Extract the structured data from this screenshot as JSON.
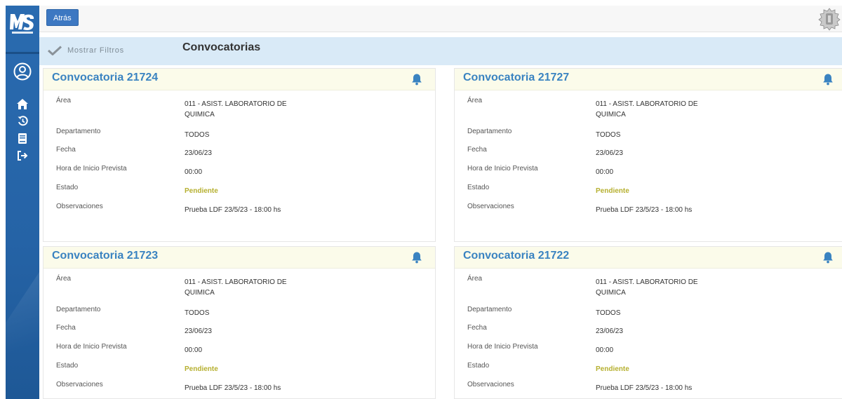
{
  "topbar": {
    "back_label": "Atrás"
  },
  "filterbar": {
    "filter_label": "Mostrar Filtros",
    "page_title": "Convocatorias"
  },
  "sidebar": {
    "items": [
      "profile-icon",
      "home-icon",
      "history-icon",
      "book-icon",
      "logout-icon"
    ]
  },
  "field_labels": {
    "area": "Área",
    "departamento": "Departamento",
    "fecha": "Fecha",
    "hora": "Hora de Inicio Prevista",
    "estado": "Estado",
    "observaciones": "Observaciones"
  },
  "cards": [
    {
      "title": "Convocatoria 21724",
      "area": "011 - ASIST. LABORATORIO DE QUIMICA",
      "departamento": "TODOS",
      "fecha": "23/06/23",
      "hora": "00:00",
      "estado": "Pendiente",
      "observaciones": "Prueba LDF 23/5/23 - 18:00 hs"
    },
    {
      "title": "Convocatoria 21727",
      "area": "011 - ASIST. LABORATORIO DE QUIMICA",
      "departamento": "TODOS",
      "fecha": "23/06/23",
      "hora": "00:00",
      "estado": "Pendiente",
      "observaciones": "Prueba LDF 23/5/23 - 18:00 hs"
    },
    {
      "title": "Convocatoria 21723",
      "area": "011 - ASIST. LABORATORIO DE QUIMICA",
      "departamento": "TODOS",
      "fecha": "23/06/23",
      "hora": "00:00",
      "estado": "Pendiente",
      "observaciones": "Prueba LDF 23/5/23 - 18:00 hs"
    },
    {
      "title": "Convocatoria 21722",
      "area": "011 - ASIST. LABORATORIO DE QUIMICA",
      "departamento": "TODOS",
      "fecha": "23/06/23",
      "hora": "00:00",
      "estado": "Pendiente",
      "observaciones": "Prueba LDF 23/5/23 - 18:00 hs"
    }
  ],
  "colors": {
    "sidebar": "#2a6bb0",
    "accent": "#3a83c1",
    "pending": "#b6b030",
    "card_header": "#fbfbea",
    "filterbar": "#d9eaf7"
  }
}
